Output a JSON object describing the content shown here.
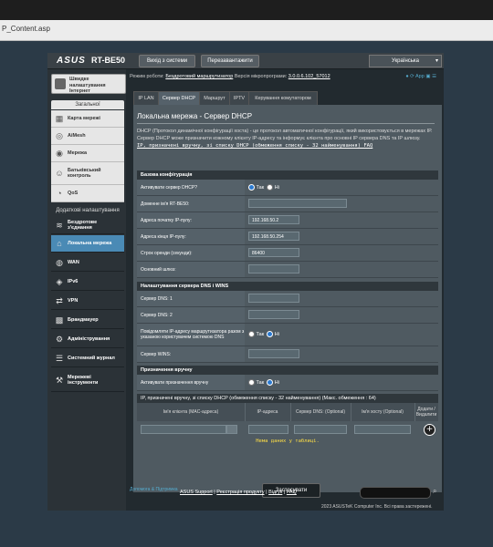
{
  "browser": {
    "url_tail": "P_Content.asp"
  },
  "header": {
    "logo": "ASUS",
    "model": "RT-BE50",
    "logout": "Вихід з системи",
    "reboot": "Перезавантажити",
    "language": "Українська"
  },
  "status": {
    "mode_label": "Режим роботи:",
    "mode_value": "Бездротовий маршрутизатор",
    "fw_label": "Версія мікропрограми:",
    "fw_value": "3.0.0.6.102_57012",
    "app_label": "App"
  },
  "sidebar": {
    "quick_setup": "Швидке налаштування Інтернет",
    "general": "Загальної",
    "general_items": [
      {
        "label": "Карта мережі",
        "icon": "map-icon"
      },
      {
        "label": "AiMesh",
        "icon": "mesh-icon"
      },
      {
        "label": "Мережа",
        "icon": "network-icon"
      },
      {
        "label": "Батьківський контроль",
        "icon": "parental-icon"
      },
      {
        "label": "QoS",
        "icon": "qos-icon"
      }
    ],
    "advanced": "Додаткові налаштування",
    "advanced_items": [
      {
        "label": "Бездротове з'єднання",
        "icon": "wifi-icon"
      },
      {
        "label": "Локальна мережа",
        "icon": "lan-icon"
      },
      {
        "label": "WAN",
        "icon": "globe-icon"
      },
      {
        "label": "IPv6",
        "icon": "ipv6-icon"
      },
      {
        "label": "VPN",
        "icon": "vpn-icon"
      },
      {
        "label": "Брандмауер",
        "icon": "firewall-icon"
      },
      {
        "label": "Адміністрування",
        "icon": "admin-icon"
      },
      {
        "label": "Системний журнал",
        "icon": "log-icon"
      },
      {
        "label": "Мережеві інструменти",
        "icon": "tools-icon"
      }
    ]
  },
  "tabs": [
    "IP LAN",
    "Сервер DHCP",
    "Маршрут",
    "IPTV",
    "Керування комутатором"
  ],
  "page": {
    "title": "Локальна мережа - Сервер DHCP",
    "desc": "DHCP (Протокол динамічної конфігурації хоста) - це протокол автоматичної конфігурації, який використовується в мережах IP. Сервер DHCP може призначити кожному клієнту IP-адресу та інформує клієнта про основні IP сервера DNS та IP шлюзу.",
    "link": "IP, призначені вручну, зі списку DHCP (обмеження списку - 32 найменування) FAQ"
  },
  "basic": {
    "section": "Базова конфігурація",
    "enable_label": "Активувати сервер DHCP?",
    "yes": "Так",
    "no": "Ні",
    "domain_label": "Доменне ім'я RT-BE50:",
    "domain_value": "",
    "start_label": "Адреса початку IP-пулу:",
    "start_value": "192.168.50.2",
    "end_label": "Адреса кінця IP-пулу:",
    "end_value": "192.168.50.254",
    "lease_label": "Строк оренди (секунди):",
    "lease_value": "86400",
    "gw_label": "Основний шлюз:",
    "gw_value": ""
  },
  "dns": {
    "section": "Налаштування сервера DNS і WINS",
    "dns1_label": "Сервер DNS: 1",
    "dns2_label": "Сервер DNS: 2",
    "adv_label": "Повідомляти IP-адресу маршрутизатора разом з указаною користувачем системою DNS",
    "wins_label": "Сервер WINS:"
  },
  "manual": {
    "section": "Призначення вручну",
    "enable_label": "Активувати призначення вручну",
    "list_header": "IP, призначені вручну, зі списку DHCP (обмеження списку - 32 найменування) (Макс. обмеження : 64)",
    "cols": [
      "Ім'я клієнта (MAC-адреса)",
      "IP-адреса",
      "Сервер DNS: (Optional)",
      "Ім'я хосту (Optional)",
      "Додати / Видалити"
    ],
    "empty": "Нема даних у таблиці."
  },
  "apply": "Застосувати",
  "footer": {
    "help": "Допомога & Підтримка",
    "links": [
      "ASUS Support",
      "Реєстрація продукту",
      "Відгук",
      "FAQ"
    ],
    "copyright": "2023 ASUSTeK Computer Inc. Всі права застережені."
  }
}
